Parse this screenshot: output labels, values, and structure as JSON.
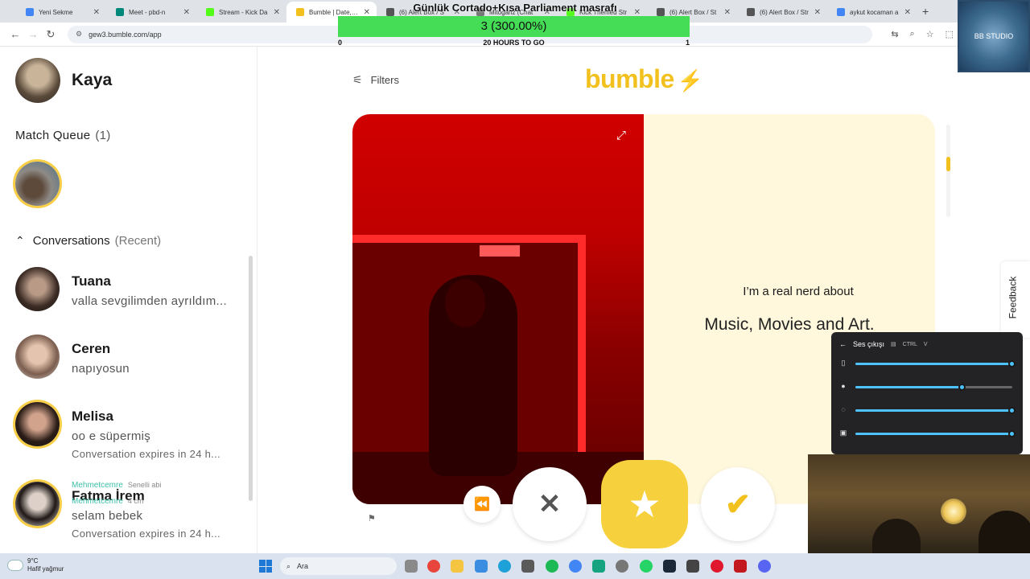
{
  "browser": {
    "tabs": [
      {
        "label": "Yeni Sekme",
        "color": "#4285f4",
        "active": false
      },
      {
        "label": "Meet - pbd-n",
        "color": "#00897b",
        "active": false
      },
      {
        "label": "Stream - Kick Da",
        "color": "#53fc18",
        "active": false
      },
      {
        "label": "Bumble | Date, Ch",
        "color": "#f2c11d",
        "active": true
      },
      {
        "label": "(6) Alert Box / S",
        "color": "#555555",
        "active": false
      },
      {
        "label": "Mitoganz (Chat",
        "color": "#777777",
        "active": false
      },
      {
        "label": "Kick Themed Str",
        "color": "#53fc18",
        "active": false
      },
      {
        "label": "(6) Alert Box / St",
        "color": "#555555",
        "active": false
      },
      {
        "label": "(6) Alert Box / Str",
        "color": "#555555",
        "active": false
      },
      {
        "label": "aykut kocaman a",
        "color": "#4285f4",
        "active": false
      }
    ],
    "url": "gew3.bumble.com/app"
  },
  "overlay": {
    "title": "Günlük Cortado+Kısa Parliament masrafı",
    "progress_text": "3 (300.00%)",
    "min_label": "0",
    "goal_label": "20 HOURS TO GO",
    "max_label": "1",
    "logo_text": "BB STUDIO"
  },
  "sidebar": {
    "me_name": "Kaya",
    "match_queue_label": "Match Queue",
    "match_queue_count": "(1)",
    "conversations_label": "Conversations",
    "conversations_sub": "(Recent)",
    "conversations": [
      {
        "name": "Tuana",
        "message": "valla sevgilimden ayrıldım...",
        "expires": "",
        "ring": false
      },
      {
        "name": "Ceren",
        "message": "napıyosun",
        "expires": "",
        "ring": false
      },
      {
        "name": "Melisa",
        "message": "oo e süpermiş",
        "expires": "Conversation expires in 24 h...",
        "ring": true
      },
      {
        "name": "Fatma İrem",
        "message": "selam bebek",
        "expires": "Conversation expires in 24 h...",
        "ring": true
      }
    ],
    "chat_overlay_1": "Mehmetcemre",
    "chat_overlay_1_sub": "Senelli abi",
    "chat_overlay_2": "Mehmetcemre",
    "chat_overlay_2_sub": "4 cm"
  },
  "main": {
    "filters_label": "Filters",
    "logo": "bumble",
    "nerd_label": "I’m a real nerd about",
    "nerd_value": "Music, Movies and Art.",
    "feedback_label": "Feedback"
  },
  "mixer": {
    "title": "Ses çıkışı",
    "hotkey_a": "CTRL",
    "hotkey_b": "V",
    "levels": [
      1.0,
      0.68,
      1.0,
      1.0
    ]
  },
  "taskbar": {
    "temp": "9°C",
    "weather": "Hafif yağmur",
    "search_placeholder": "Ara"
  },
  "colors": {
    "brand": "#f2c11d",
    "progress": "#44dd55",
    "mixer_accent": "#4cc2ff"
  }
}
